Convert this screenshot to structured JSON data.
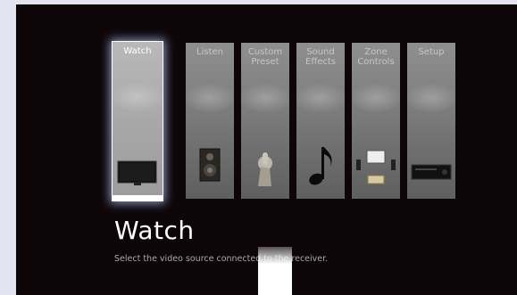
{
  "menu": {
    "items": [
      {
        "label": "Watch",
        "selected": true,
        "icon": "tv-icon"
      },
      {
        "label": "Listen",
        "selected": false,
        "icon": "speaker-icon"
      },
      {
        "label": "Custom\nPreset",
        "selected": false,
        "icon": "finger-press-icon"
      },
      {
        "label": "Sound\nEffects",
        "selected": false,
        "icon": "music-note-icon"
      },
      {
        "label": "Zone\nControls",
        "selected": false,
        "icon": "zones-icon"
      },
      {
        "label": "Setup",
        "selected": false,
        "icon": "receiver-icon"
      }
    ]
  },
  "detail": {
    "title": "Watch",
    "description": "Select the video source connected to the receiver."
  }
}
